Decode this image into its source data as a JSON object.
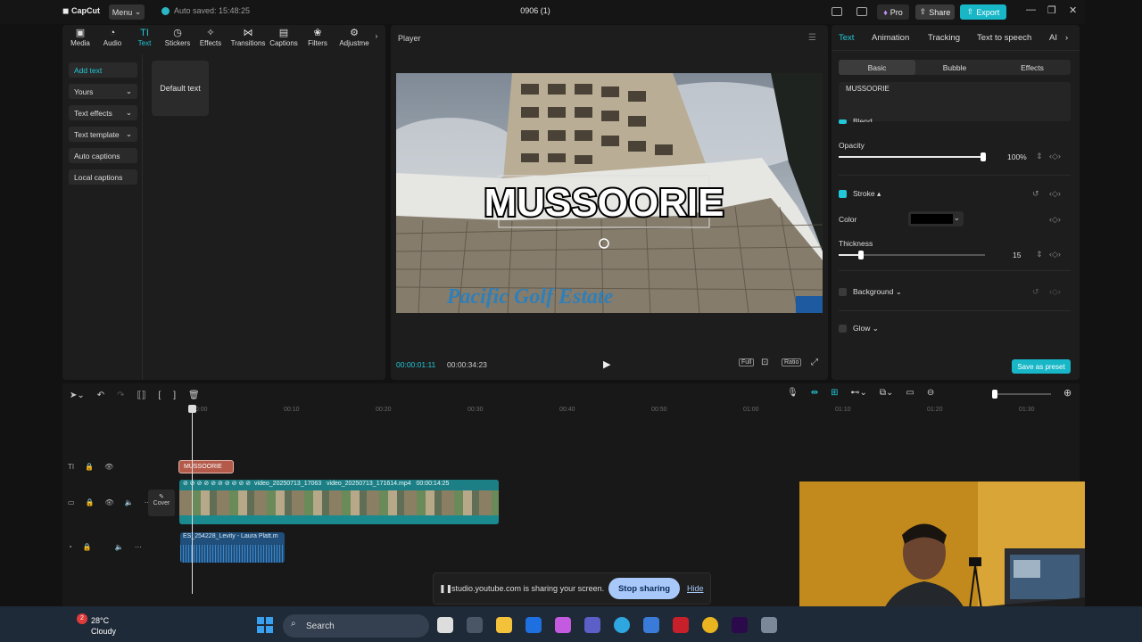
{
  "titlebar": {
    "logo": "CapCut",
    "menu": "Menu",
    "autosave": "Auto saved: 15:48:25",
    "doc_title": "0906 (1)",
    "pro": "Pro",
    "share": "Share",
    "export": "Export"
  },
  "toolbar": {
    "items": [
      {
        "label": "Media",
        "icon": "media-icon"
      },
      {
        "label": "Audio",
        "icon": "audio-icon"
      },
      {
        "label": "Text",
        "icon": "text-icon",
        "active": true
      },
      {
        "label": "Stickers",
        "icon": "sticker-icon"
      },
      {
        "label": "Effects",
        "icon": "effects-icon"
      },
      {
        "label": "Transitions",
        "icon": "transitions-icon"
      },
      {
        "label": "Captions",
        "icon": "captions-icon"
      },
      {
        "label": "Filters",
        "icon": "filters-icon"
      },
      {
        "label": "Adjustme",
        "icon": "adjustment-icon"
      }
    ]
  },
  "left_sub": {
    "items": [
      "Add text",
      "Yours",
      "Text effects",
      "Text template",
      "Auto captions",
      "Local captions"
    ],
    "default_text": "Default text"
  },
  "player": {
    "title": "Player",
    "overlay_text": "MUSSOORIE",
    "sign_text": "Pacific Golf Estate",
    "current_time": "00:00:01:11",
    "total_time": "00:00:34:23",
    "full_label": "Full",
    "ratio_label": "Ratio"
  },
  "right_panel": {
    "tabs": [
      "Text",
      "Animation",
      "Tracking",
      "Text to speech",
      "AI"
    ],
    "subtabs": [
      "Basic",
      "Bubble",
      "Effects"
    ],
    "text_value": "MUSSOORIE",
    "blend_label": "Blend",
    "opacity_label": "Opacity",
    "opacity_value": "100%",
    "opacity_level": 1.0,
    "stroke_label": "Stroke",
    "color_label": "Color",
    "stroke_color": "#000000",
    "thickness_label": "Thickness",
    "thickness_value": "15",
    "thickness_level": 0.15,
    "background_label": "Background",
    "glow_label": "Glow",
    "save_preset": "Save as preset"
  },
  "timeline": {
    "ruler": [
      "00:00",
      "00:10",
      "00:20",
      "00:30",
      "00:40",
      "00:50",
      "01:00",
      "01:10",
      "01:20",
      "01:30"
    ],
    "text_clip": "MUSSOORIE",
    "video_labels": [
      "video_20250713_17063",
      "video_20250713_171614.mp4",
      "00:00:14:25"
    ],
    "audio_label": "ES_254228_Levity - Laura Platt.m",
    "cover_label": "Cover"
  },
  "sharebar": {
    "message": "studio.youtube.com is sharing your screen.",
    "stop": "Stop sharing",
    "hide": "Hide"
  },
  "taskbar": {
    "temp": "28°C",
    "condition": "Cloudy",
    "search": "Search",
    "weather_badge": "2"
  }
}
